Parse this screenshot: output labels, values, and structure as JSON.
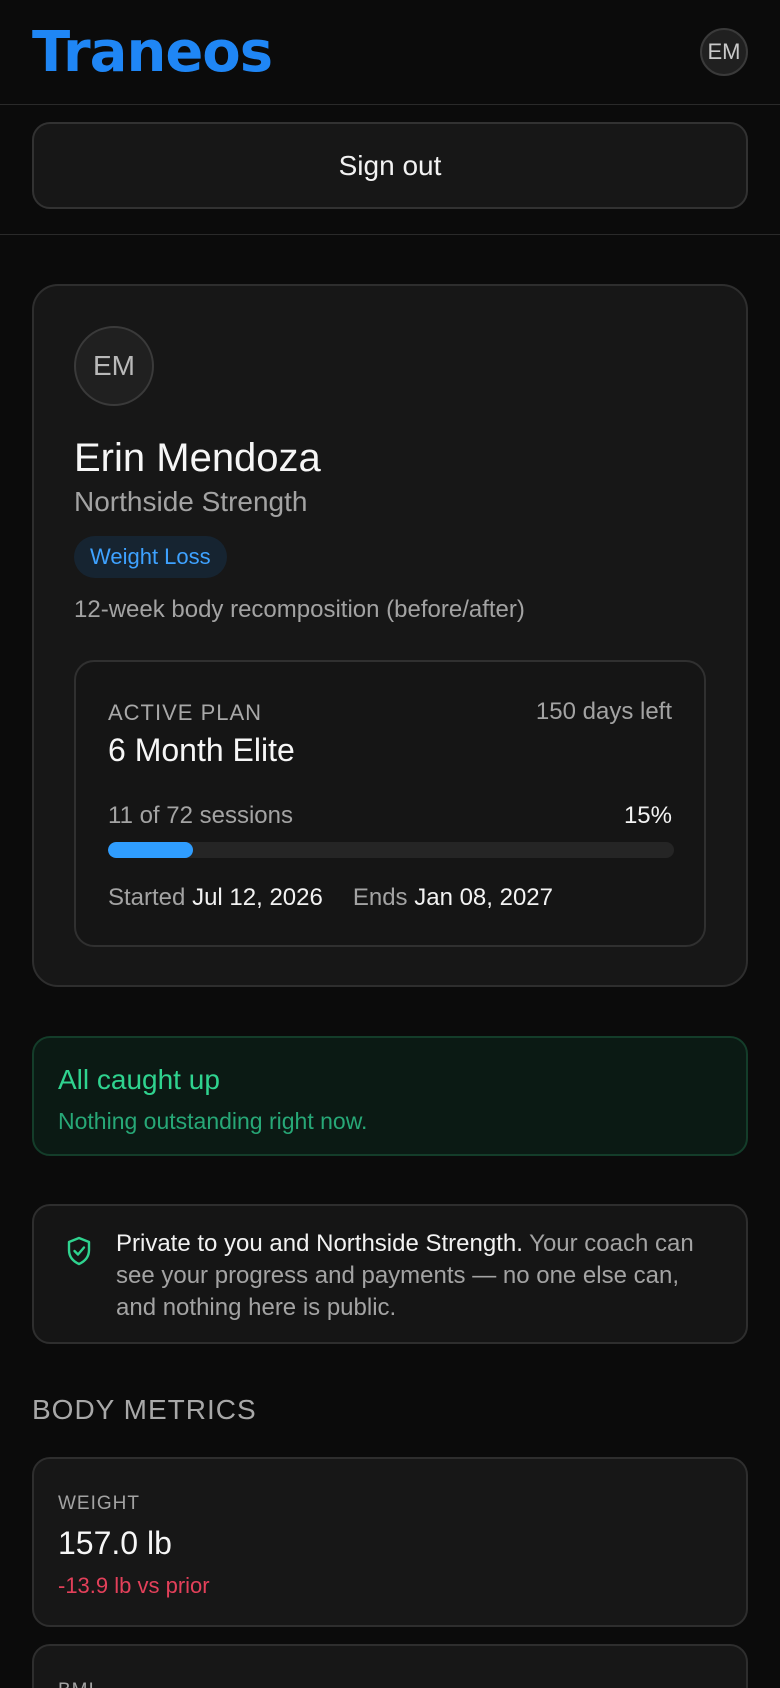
{
  "header": {
    "logo": "Traneos",
    "avatar_initials": "EM"
  },
  "actions": {
    "sign_out_label": "Sign out"
  },
  "profile": {
    "initials": "EM",
    "name": "Erin Mendoza",
    "gym": "Northside Strength",
    "tag": "Weight Loss",
    "goal": "12-week body recomposition (before/after)"
  },
  "plan": {
    "kicker": "ACTIVE PLAN",
    "days_left": "150 days left",
    "name": "6 Month Elite",
    "sessions": "11 of 72 sessions",
    "percent": "15%",
    "progress_fraction": 0.15,
    "started_label": "Started",
    "started_date": "Jul 12, 2026",
    "ends_label": "Ends",
    "ends_date": "Jan 08, 2027"
  },
  "status": {
    "title": "All caught up",
    "subtitle": "Nothing outstanding right now."
  },
  "privacy": {
    "icon": "shield-check-icon",
    "strong": "Private to you and Northside Strength.",
    "rest": " Your coach can see your progress and payments — no one else can, and nothing here is public."
  },
  "metrics": {
    "section_title": "BODY METRICS",
    "weight": {
      "label": "WEIGHT",
      "value": "157.0 lb",
      "delta": "-13.9 lb vs prior"
    },
    "bmi": {
      "label": "BMI"
    }
  },
  "colors": {
    "brand": "#1f86f5",
    "accent": "#2f9dff",
    "success": "#2fd38f",
    "negative": "#e3405a",
    "background": "#0b0b0b"
  }
}
